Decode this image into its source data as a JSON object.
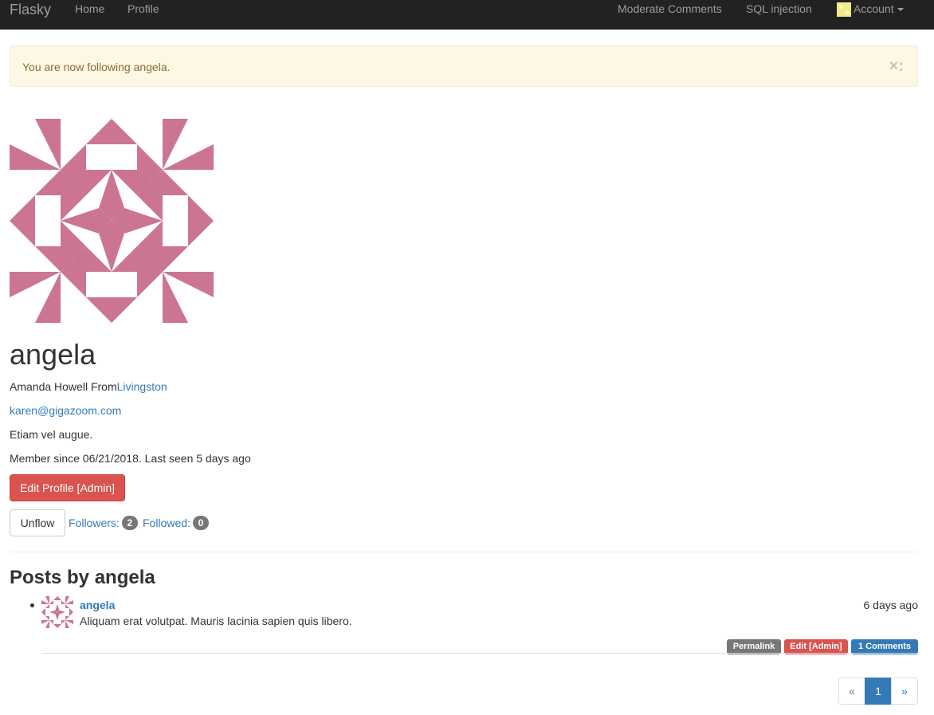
{
  "navbar": {
    "brand": "Flasky",
    "left_links": [
      "Home",
      "Profile"
    ],
    "right_links": [
      "Moderate Comments",
      "SQL injection"
    ],
    "account_label": "Account"
  },
  "alert": {
    "message": "You are now following angela.",
    "close_glyph": "×:"
  },
  "profile": {
    "username": "angela",
    "name_prefix": "Amanda Howell From",
    "location": "Livingston",
    "email": "karen@gigazoom.com",
    "about": "Etiam vel augue.",
    "member_info": "Member since 06/21/2018. Last seen 5 days ago",
    "edit_button": "Edit Profile [Admin]",
    "unfollow_button": "Unflow",
    "followers_label": "Followers:",
    "followers_count": "2",
    "followed_label": "Followed:",
    "followed_count": "0",
    "avatar_color": "#cc7591"
  },
  "posts_section": {
    "title": "Posts by angela",
    "posts": [
      {
        "author": "angela",
        "date": "6 days ago",
        "body": "Aliquam erat volutpat. Mauris lacinia sapien quis libero.",
        "permalink_label": "Permalink",
        "edit_label": "Edit [Admin]",
        "comments_label": "1 Comments"
      }
    ]
  },
  "pagination": {
    "prev": "«",
    "current": "1",
    "next": "»"
  },
  "colors": {
    "danger": "#d9534f",
    "primary": "#337ab7",
    "label_default": "#777777"
  }
}
